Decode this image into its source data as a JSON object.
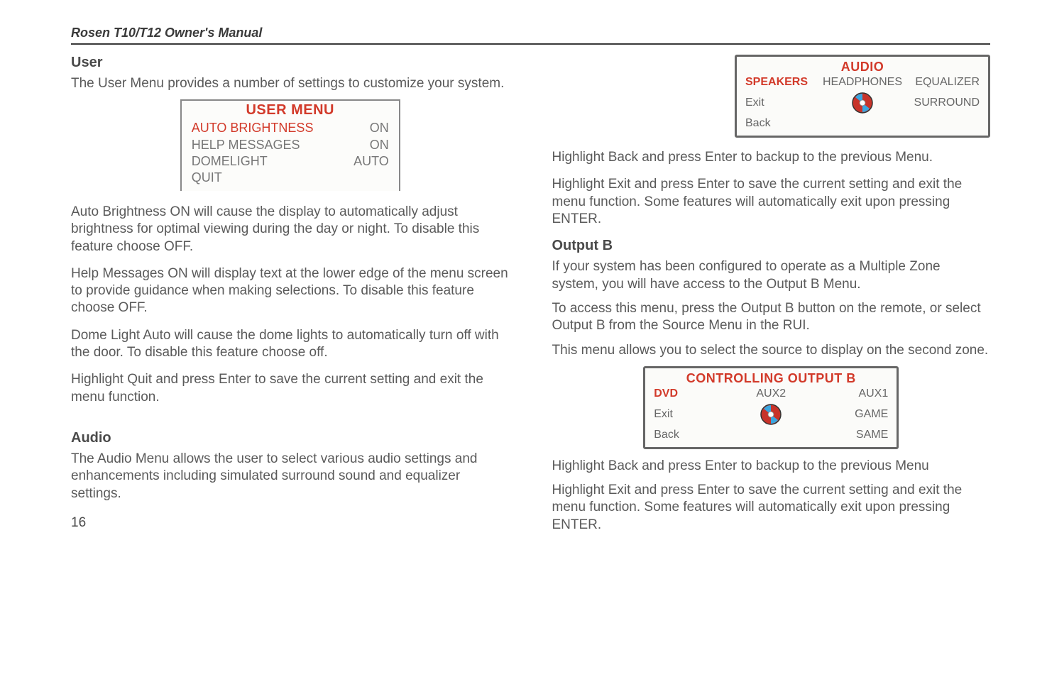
{
  "running_head": "Rosen T10/T12 Owner's Manual",
  "page_number": "16",
  "left": {
    "user": {
      "heading": "User",
      "intro": "The User Menu provides a number of settings to customize your system.",
      "fig": {
        "title": "USER MENU",
        "rows": [
          {
            "label": "AUTO BRIGHTNESS",
            "val": "ON"
          },
          {
            "label": "HELP MESSAGES",
            "val": "ON"
          },
          {
            "label": "DOMELIGHT",
            "val": "AUTO"
          },
          {
            "label": "QUIT",
            "val": ""
          }
        ]
      },
      "p1": "Auto Brightness ON will cause the display to automatically adjust brightness for optimal viewing during the day or night.  To disable this feature choose OFF.",
      "p2": "Help Messages ON will display text at the lower edge of the menu screen to provide guidance when making selections.  To disable this feature choose OFF.",
      "p3": "Dome Light Auto will cause the dome lights to automatically turn off with the door.  To disable this feature choose off.",
      "p4": "Highlight Quit and press Enter to save the current setting and exit the menu function."
    },
    "audio": {
      "heading": "Audio",
      "p1": "The Audio Menu allows the user to select various audio settings and enhancements including simulated surround sound and equalizer settings."
    }
  },
  "right": {
    "audio_panel": {
      "title": "AUDIO",
      "l1": "SPEAKERS",
      "c1": "HEADPHONES",
      "r1": "EQUALIZER",
      "l2": "Exit",
      "r2": "SURROUND",
      "l3": "Back"
    },
    "audio_after": {
      "p1": "Highlight Back and press Enter to backup to the previous Menu.",
      "p2": "Highlight Exit and press Enter to save the current setting and exit the menu function.  Some features will automatically exit upon pressing ENTER."
    },
    "outputb": {
      "heading": "Output B",
      "p1": "If your system has been configured to operate as a Multiple Zone system, you will have access to the Output B Menu.",
      "p2": "To access this menu, press the Output B button on the remote, or select Output B from the Source Menu in the RUI.",
      "p3": "This menu allows you to select the source to display on the second zone.",
      "panel": {
        "title": "CONTROLLING OUTPUT B",
        "l1": "DVD",
        "c1": "AUX2",
        "r1": "AUX1",
        "l2": "Exit",
        "r2": "GAME",
        "l3": "Back",
        "r3": "SAME"
      },
      "p4": "Highlight Back and press Enter to backup to the previous Menu",
      "p5": "Highlight Exit and press Enter to save the current setting and exit the menu function.  Some features will automatically exit upon pressing ENTER."
    }
  }
}
